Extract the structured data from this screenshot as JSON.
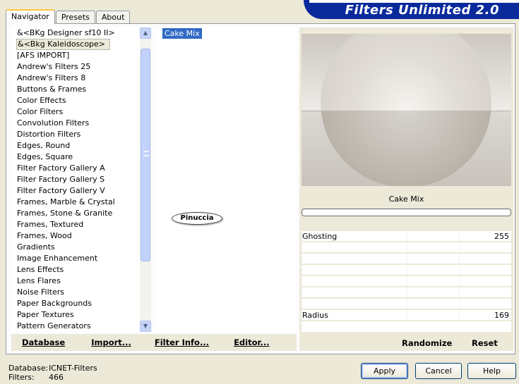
{
  "tabs": [
    "Navigator",
    "Presets",
    "About"
  ],
  "app_title": "Filters Unlimited 2.0",
  "categories": [
    "&<BKg Designer sf10 II>",
    "&<Bkg Kaleidoscope>",
    "[AFS IMPORT]",
    "Andrew's Filters 25",
    "Andrew's Filters 8",
    "Buttons & Frames",
    "Color Effects",
    "Color Filters",
    "Convolution Filters",
    "Distortion Filters",
    "Edges, Round",
    "Edges, Square",
    "Filter Factory Gallery A",
    "Filter Factory Gallery S",
    "Filter Factory Gallery V",
    "Frames, Marble & Crystal",
    "Frames, Stone & Granite",
    "Frames, Textured",
    "Frames, Wood",
    "Gradients",
    "Image Enhancement",
    "Lens Effects",
    "Lens Flares",
    "Noise Filters",
    "Paper Backgrounds",
    "Paper Textures",
    "Pattern Generators"
  ],
  "selected_category": "&<Bkg Kaleidoscope>",
  "filters": [
    "Cake Mix"
  ],
  "selected_filter": "Cake Mix",
  "watermark": "Pinuccia",
  "bottom": {
    "database": "Database",
    "import": "Import...",
    "filter_info": "Filter Info...",
    "editor": "Editor..."
  },
  "preview": {
    "filter_name": "Cake Mix",
    "progress": 0
  },
  "params": [
    {
      "label": "Ghosting",
      "value": "255"
    },
    {
      "label": "",
      "value": ""
    },
    {
      "label": "",
      "value": ""
    },
    {
      "label": "",
      "value": ""
    },
    {
      "label": "",
      "value": ""
    },
    {
      "label": "",
      "value": ""
    },
    {
      "label": "",
      "value": ""
    },
    {
      "label": "Radius",
      "value": "169"
    }
  ],
  "actions": {
    "randomize": "Randomize",
    "reset": "Reset"
  },
  "status": {
    "database_label": "Database:",
    "database_value": "ICNET-Filters",
    "filters_label": "Filters:",
    "filters_value": "466"
  },
  "buttons": {
    "apply": "Apply",
    "cancel": "Cancel",
    "help": "Help"
  },
  "colors": {
    "banner": "#0a2a9c",
    "selection": "#316ac5",
    "face": "#ece9d8"
  }
}
